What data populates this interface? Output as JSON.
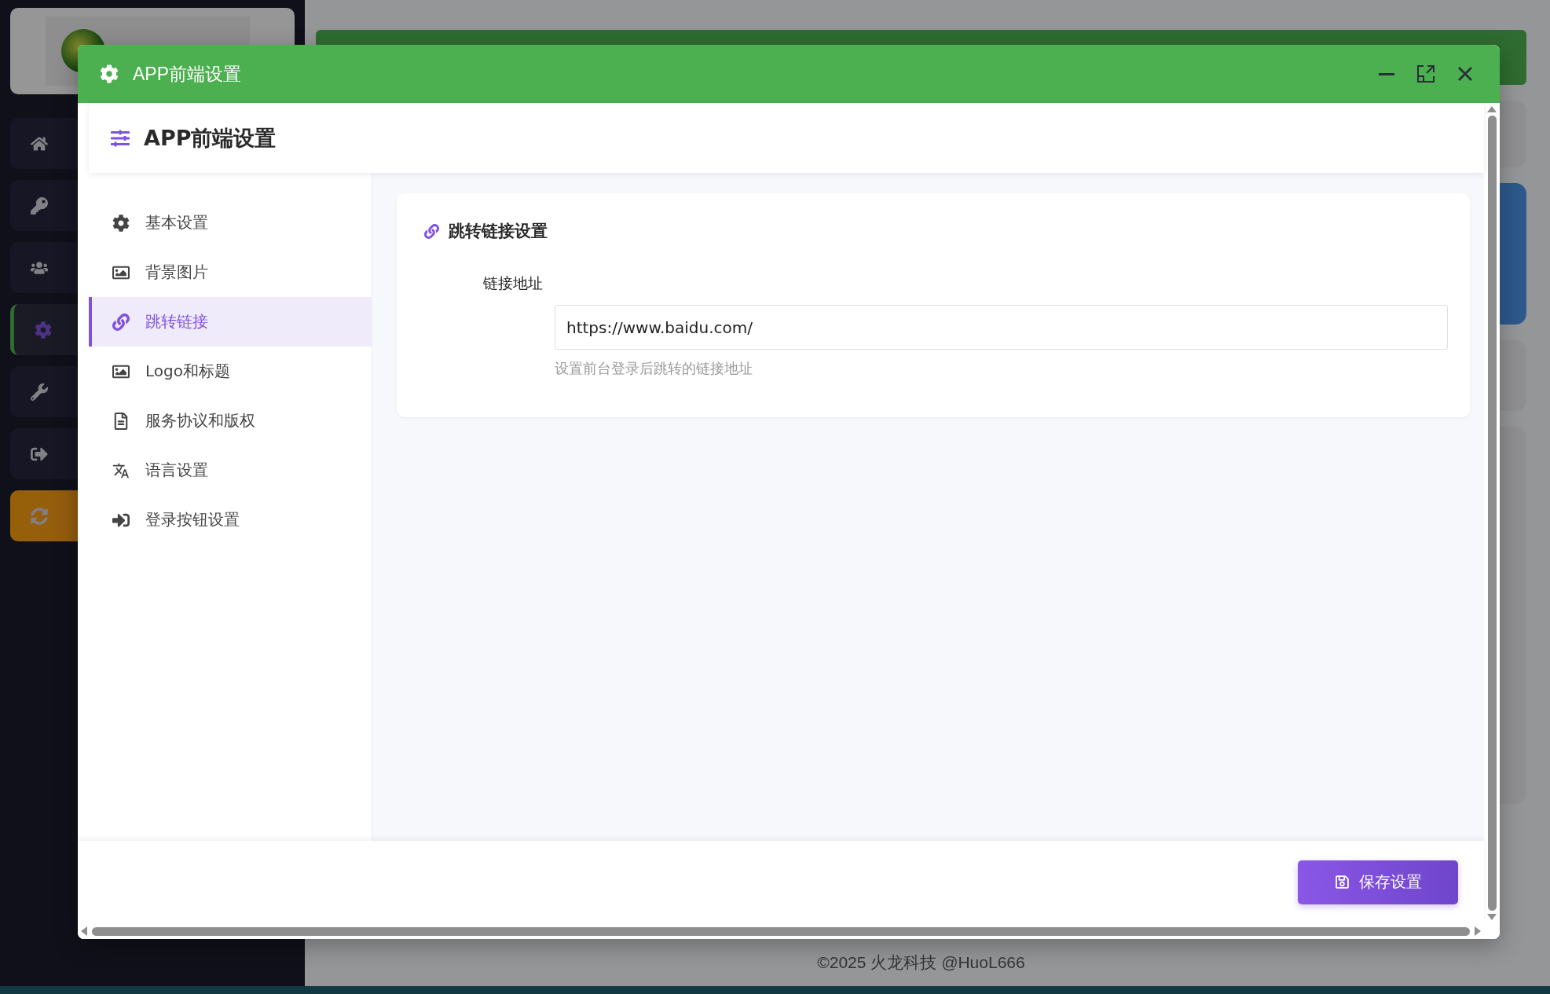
{
  "background": {
    "sidebar": {
      "items": [
        {
          "active": false,
          "kind": "nav"
        },
        {
          "active": false,
          "kind": "nav"
        },
        {
          "active": false,
          "kind": "nav"
        },
        {
          "active": true,
          "kind": "nav"
        },
        {
          "active": false,
          "kind": "nav"
        },
        {
          "active": false,
          "kind": "nav"
        },
        {
          "active": false,
          "kind": "action"
        }
      ]
    },
    "footer": "©2025 火龙科技 @HuoL666"
  },
  "modal": {
    "title": "APP前端设置",
    "page_title": "APP前端设置",
    "nav": [
      {
        "label": "基本设置",
        "selected": false
      },
      {
        "label": "背景图片",
        "selected": false
      },
      {
        "label": "跳转链接",
        "selected": true
      },
      {
        "label": "Logo和标题",
        "selected": false
      },
      {
        "label": "服务协议和版权",
        "selected": false
      },
      {
        "label": "语言设置",
        "selected": false
      },
      {
        "label": "登录按钮设置",
        "selected": false
      }
    ],
    "section": {
      "title": "跳转链接设置",
      "field": {
        "label": "链接地址",
        "value": "https://www.baidu.com/",
        "help": "设置前台登录后跳转的链接地址"
      }
    },
    "save_button": "保存设置"
  }
}
